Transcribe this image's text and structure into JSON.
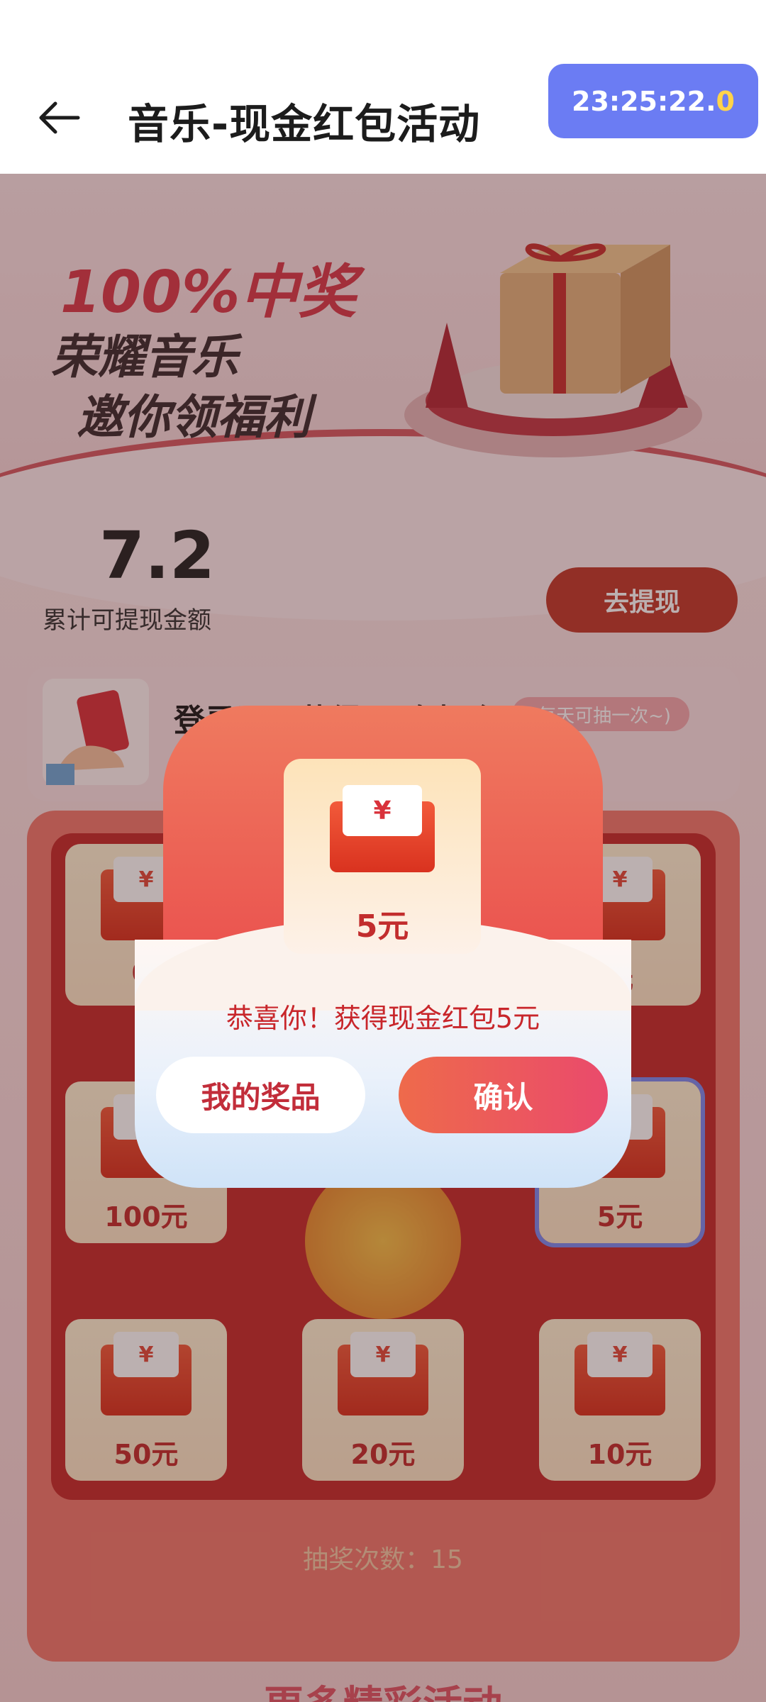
{
  "header": {
    "title": "音乐-现金红包活动",
    "timer_main": "23:25:22.",
    "timer_last": "0"
  },
  "banner": {
    "line1": "100%中奖",
    "line2": "荣耀音乐",
    "line3": "邀你领福利"
  },
  "balance": {
    "amount": "7.2",
    "label": "累计可提现金额",
    "withdraw": "去提现"
  },
  "info": {
    "text": "登录即可获得30次机会",
    "tag": "(每天可抽一次~)"
  },
  "grid": {
    "currency": "¥",
    "cells": [
      {
        "value": "0."
      },
      {
        "value": "元"
      },
      {
        "value": "100元"
      },
      {
        "value": "5元"
      },
      {
        "value": "50元"
      },
      {
        "value": "20元"
      },
      {
        "value": "10元"
      }
    ],
    "count_label": "抽奖次数：15"
  },
  "bottom_title": "更多精彩活动",
  "modal": {
    "currency": "¥",
    "prize": "5元",
    "congrats": "恭喜你！获得现金红包5元",
    "my_prize": "我的奖品",
    "confirm": "确认"
  },
  "colors": {
    "timer_bg": "#6b7cf3",
    "accent_red": "#c22d2d",
    "confirm_gradient": "#ee6a4b-#ea4a6c"
  }
}
